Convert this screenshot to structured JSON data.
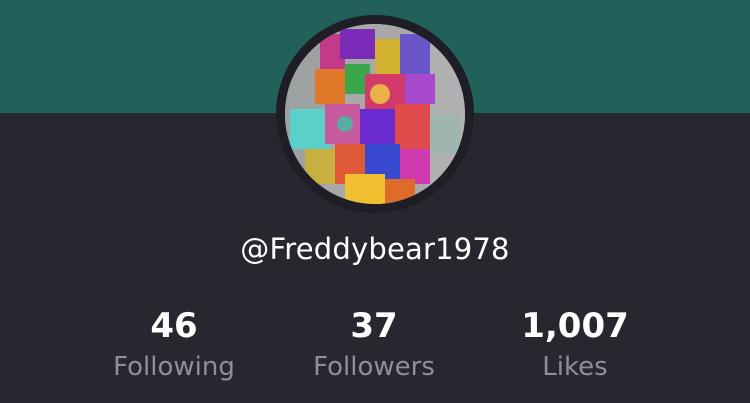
{
  "profile": {
    "username": "@Freddybear1978"
  },
  "stats": [
    {
      "value": "46",
      "label": "Following"
    },
    {
      "value": "37",
      "label": "Followers"
    },
    {
      "value": "1,007",
      "label": "Likes"
    }
  ],
  "colors": {
    "cover": "#22605a",
    "background": "#282730",
    "avatar_ring": "#1f1e26",
    "label_gray": "#8f8e99"
  },
  "icons": {
    "avatar": "profile-avatar-image"
  }
}
